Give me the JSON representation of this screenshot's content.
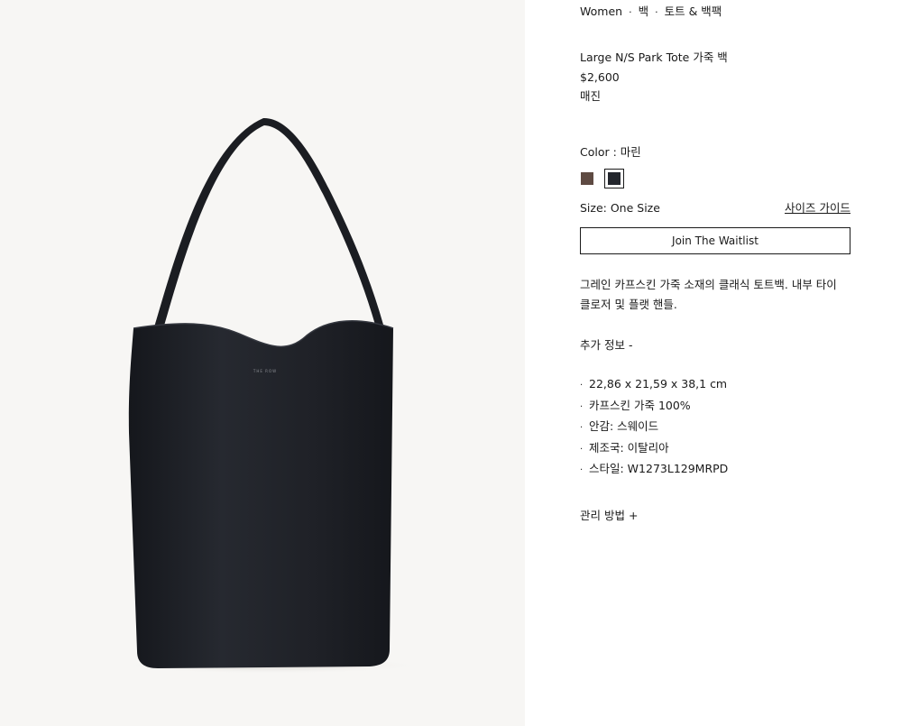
{
  "breadcrumb": {
    "items": [
      "Women",
      "백",
      "토트 & 백팩"
    ],
    "separator": "·"
  },
  "product": {
    "name": "Large N/S Park Tote 가죽 백",
    "price": "$2,600",
    "stock_status": "매진",
    "image_logo_text": "THE ROW"
  },
  "color": {
    "label": "Color : 마린",
    "options": [
      {
        "name": "brown",
        "hex": "#5e4a42",
        "selected": false
      },
      {
        "name": "마린",
        "hex": "#23262d",
        "selected": true
      }
    ]
  },
  "size": {
    "label": "Size: One Size",
    "guide_label": "사이즈 가이드"
  },
  "waitlist_button": "Join The Waitlist",
  "description": "그레인 카프스킨 가죽 소재의 클래식 토트백. 내부 타이 클로저 및 플랫 핸들.",
  "more_info_label": "추가 정보 -",
  "specs": [
    "22,86 x 21,59 x 38,1 cm",
    "카프스킨 가죽 100%",
    "안감: 스웨이드",
    "제조국: 이탈리아",
    "스타일: W1273L129MRPD"
  ],
  "care_label": "관리 방법 +",
  "colors": {
    "image_background": "#f7f6f4",
    "bag": "#1e2026",
    "text": "#1a1a1a"
  }
}
